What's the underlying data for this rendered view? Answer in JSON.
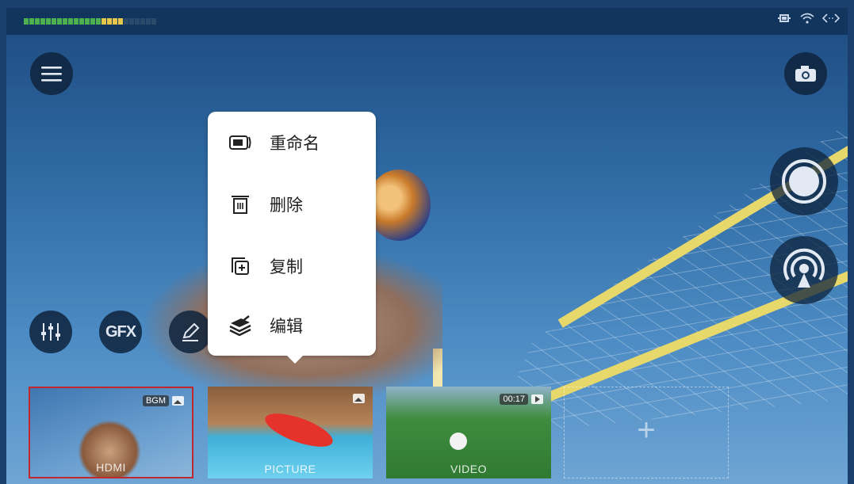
{
  "status_bar": {
    "audio_meter_icon": "audio-level-meter",
    "icons": [
      "battery-icon",
      "wifi-icon",
      "code-icon"
    ]
  },
  "left_controls": {
    "menu_icon": "hamburger-icon",
    "mixer_icon": "sliders-icon",
    "gfx_label": "GFX",
    "edit_icon": "pencil-icon"
  },
  "right_controls": {
    "camera_icon": "camera-icon",
    "record_icon": "record-icon",
    "live_icon": "broadcast-icon"
  },
  "context_menu": {
    "items": [
      {
        "label": "重命名",
        "icon": "rename-icon"
      },
      {
        "label": "删除",
        "icon": "trash-icon"
      },
      {
        "label": "复制",
        "icon": "duplicate-icon"
      },
      {
        "label": "编辑",
        "icon": "layers-edit-icon"
      }
    ]
  },
  "sources": [
    {
      "label": "HDMI",
      "badge": "BGM",
      "selected": true
    },
    {
      "label": "PICTURE",
      "badge": ""
    },
    {
      "label": "VIDEO",
      "badge": "00:17"
    },
    {
      "label": "",
      "add": "+"
    }
  ],
  "colors": {
    "selected_border": "#c0282d",
    "topbar": "#12355e",
    "net_band": "#e7d86b"
  }
}
